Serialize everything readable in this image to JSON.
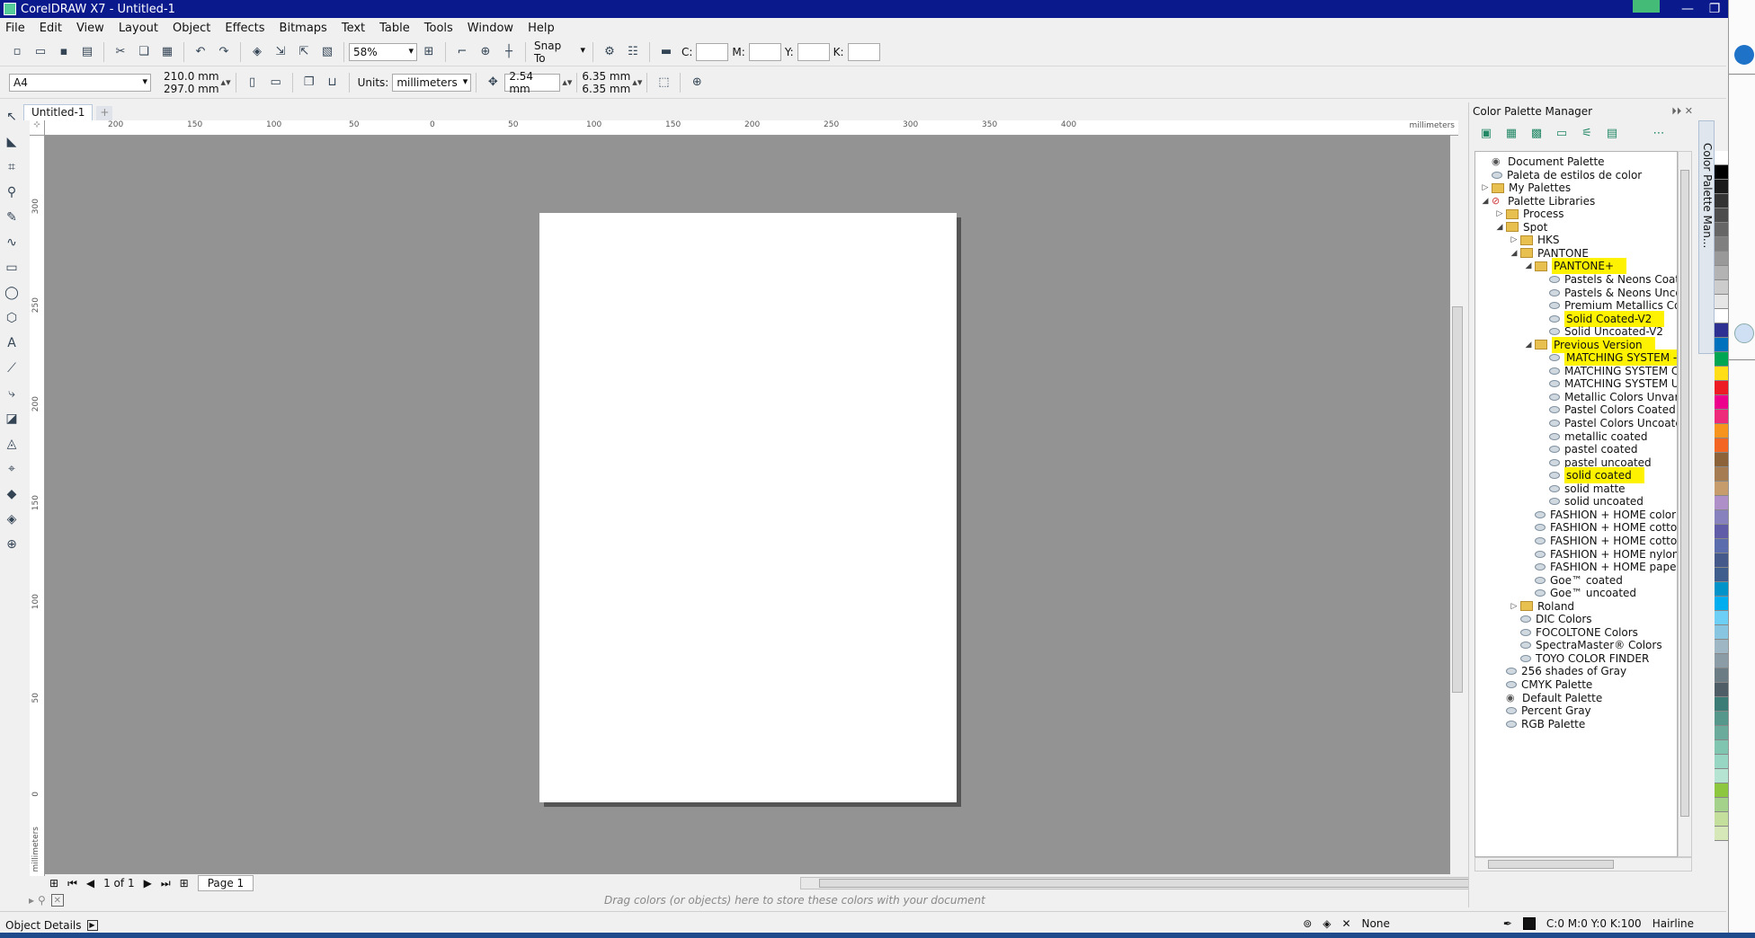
{
  "window": {
    "title": "CorelDRAW X7 - Untitled-1"
  },
  "menu": [
    "File",
    "Edit",
    "View",
    "Layout",
    "Object",
    "Effects",
    "Bitmaps",
    "Text",
    "Table",
    "Tools",
    "Window",
    "Help"
  ],
  "toolbar1": {
    "zoom": "58%",
    "snap_label": "Snap To",
    "c_label": "C:",
    "m_label": "M:",
    "y_label": "Y:",
    "k_label": "K:"
  },
  "toolbar2": {
    "paper": "A4",
    "width": "210.0 mm",
    "height": "297.0 mm",
    "units_label": "Units:",
    "units": "millimeters",
    "nudge": "2.54 mm",
    "dup_x": "6.35 mm",
    "dup_y": "6.35 mm"
  },
  "document": {
    "tab": "Untitled-1",
    "page_count": "1 of 1",
    "page_tab": "Page 1"
  },
  "ruler": {
    "h_labels": [
      "200",
      "150",
      "100",
      "50",
      "0",
      "50",
      "100",
      "150",
      "200",
      "250",
      "300",
      "350",
      "400"
    ],
    "v_labels": [
      "300",
      "250",
      "200",
      "150",
      "100",
      "50",
      "0"
    ],
    "unit": "millimeters"
  },
  "color_well_hint": "Drag colors (or objects) here to store these colors with your document",
  "status": {
    "object_details": "Object Details",
    "fill": "None",
    "outline": "C:0 M:0 Y:0 K:100",
    "outline_width": "Hairline"
  },
  "palette_manager": {
    "title": "Color Palette Manager",
    "side_tab": "Color Palette Man...",
    "highlight_color": "#fff200",
    "tree": [
      {
        "label": "Document Palette",
        "indent": 0,
        "icon": "eye",
        "highlight": false
      },
      {
        "label": "Paleta de estilos de color",
        "indent": 0,
        "icon": "palette",
        "highlight": false
      },
      {
        "label": "My Palettes",
        "indent": 0,
        "icon": "folder",
        "expander": "▷",
        "highlight": false
      },
      {
        "label": "Palette Libraries",
        "indent": 0,
        "icon": "library",
        "expander": "◢",
        "highlight": false
      },
      {
        "label": "Process",
        "indent": 1,
        "icon": "folder",
        "expander": "▷",
        "highlight": false
      },
      {
        "label": "Spot",
        "indent": 1,
        "icon": "folder",
        "expander": "◢",
        "highlight": false
      },
      {
        "label": "HKS",
        "indent": 2,
        "icon": "folder",
        "expander": "▷",
        "highlight": false
      },
      {
        "label": "PANTONE",
        "indent": 2,
        "icon": "folder",
        "expander": "◢",
        "highlight": false
      },
      {
        "label": "PANTONE+",
        "indent": 3,
        "icon": "folder",
        "expander": "◢",
        "highlight": true
      },
      {
        "label": "Pastels & Neons Coated",
        "indent": 4,
        "icon": "palette",
        "highlight": false
      },
      {
        "label": "Pastels & Neons Uncoated",
        "indent": 4,
        "icon": "palette",
        "highlight": false
      },
      {
        "label": "Premium Metallics Coated",
        "indent": 4,
        "icon": "palette",
        "highlight": false
      },
      {
        "label": "Solid Coated-V2",
        "indent": 4,
        "icon": "palette",
        "highlight": true
      },
      {
        "label": "Solid Uncoated-V2",
        "indent": 4,
        "icon": "palette",
        "highlight": false
      },
      {
        "label": "Previous Version",
        "indent": 3,
        "icon": "folder",
        "expander": "◢",
        "highlight": true
      },
      {
        "label": "MATCHING SYSTEM - (",
        "indent": 4,
        "icon": "palette",
        "highlight": true
      },
      {
        "label": "MATCHING SYSTEM Co",
        "indent": 4,
        "icon": "palette",
        "highlight": false
      },
      {
        "label": "MATCHING SYSTEM Un",
        "indent": 4,
        "icon": "palette",
        "highlight": false
      },
      {
        "label": "Metallic Colors Unvarni",
        "indent": 4,
        "icon": "palette",
        "highlight": false
      },
      {
        "label": "Pastel Colors Coated - (",
        "indent": 4,
        "icon": "palette",
        "highlight": false
      },
      {
        "label": "Pastel Colors Uncoated",
        "indent": 4,
        "icon": "palette",
        "highlight": false
      },
      {
        "label": "metallic coated",
        "indent": 4,
        "icon": "palette",
        "highlight": false
      },
      {
        "label": "pastel coated",
        "indent": 4,
        "icon": "palette",
        "highlight": false
      },
      {
        "label": "pastel uncoated",
        "indent": 4,
        "icon": "palette",
        "highlight": false
      },
      {
        "label": "solid coated",
        "indent": 4,
        "icon": "palette",
        "highlight": true
      },
      {
        "label": "solid matte",
        "indent": 4,
        "icon": "palette",
        "highlight": false
      },
      {
        "label": "solid uncoated",
        "indent": 4,
        "icon": "palette",
        "highlight": false
      },
      {
        "label": "FASHION + HOME color gu",
        "indent": 3,
        "icon": "palette",
        "highlight": false
      },
      {
        "label": "FASHION + HOME cotton",
        "indent": 3,
        "icon": "palette",
        "highlight": false
      },
      {
        "label": "FASHION + HOME cotton",
        "indent": 3,
        "icon": "palette",
        "highlight": false
      },
      {
        "label": "FASHION + HOME nylon b",
        "indent": 3,
        "icon": "palette",
        "highlight": false
      },
      {
        "label": "FASHION + HOME paper n",
        "indent": 3,
        "icon": "palette",
        "highlight": false
      },
      {
        "label": "Goe™ coated",
        "indent": 3,
        "icon": "palette",
        "highlight": false
      },
      {
        "label": "Goe™ uncoated",
        "indent": 3,
        "icon": "palette",
        "highlight": false
      },
      {
        "label": "Roland",
        "indent": 2,
        "icon": "folder",
        "expander": "▷",
        "highlight": false
      },
      {
        "label": "DIC Colors",
        "indent": 2,
        "icon": "palette",
        "highlight": false
      },
      {
        "label": "FOCOLTONE Colors",
        "indent": 2,
        "icon": "palette",
        "highlight": false
      },
      {
        "label": "SpectraMaster® Colors",
        "indent": 2,
        "icon": "palette",
        "highlight": false
      },
      {
        "label": "TOYO COLOR FINDER",
        "indent": 2,
        "icon": "palette",
        "highlight": false
      },
      {
        "label": "256 shades of Gray",
        "indent": 1,
        "icon": "palette",
        "highlight": false
      },
      {
        "label": "CMYK Palette",
        "indent": 1,
        "icon": "palette",
        "highlight": false
      },
      {
        "label": "Default Palette",
        "indent": 1,
        "icon": "eye",
        "highlight": false
      },
      {
        "label": "Percent Gray",
        "indent": 1,
        "icon": "palette",
        "highlight": false
      },
      {
        "label": "RGB Palette",
        "indent": 1,
        "icon": "palette",
        "highlight": false
      }
    ]
  },
  "swatches": [
    "#ffffff",
    "#000000",
    "#1a1a1a",
    "#333333",
    "#4d4d4d",
    "#666666",
    "#808080",
    "#999999",
    "#b3b3b3",
    "#cccccc",
    "#e6e6e6",
    "#ffffff",
    "#2e3192",
    "#0071bc",
    "#00a651",
    "#ffde17",
    "#ed1c24",
    "#ec008c",
    "#ee2a7b",
    "#f7941d",
    "#f26522",
    "#8c6239",
    "#a67c52",
    "#c69c6d",
    "#ae8fc7",
    "#8781bd",
    "#605ca8",
    "#5b6dad",
    "#455a8a",
    "#3f5e8e",
    "#0093c9",
    "#00aeef",
    "#6dcff6",
    "#87c5e0",
    "#9fb7c5",
    "#8c9ca6",
    "#6b7c85",
    "#4f5e66",
    "#3c7c77",
    "#55978a",
    "#6aab9c",
    "#7fc5b0",
    "#98d6c4",
    "#b5e4d3",
    "#8dc63f",
    "#a5d28a",
    "#c4df9b",
    "#d7e8b8"
  ]
}
